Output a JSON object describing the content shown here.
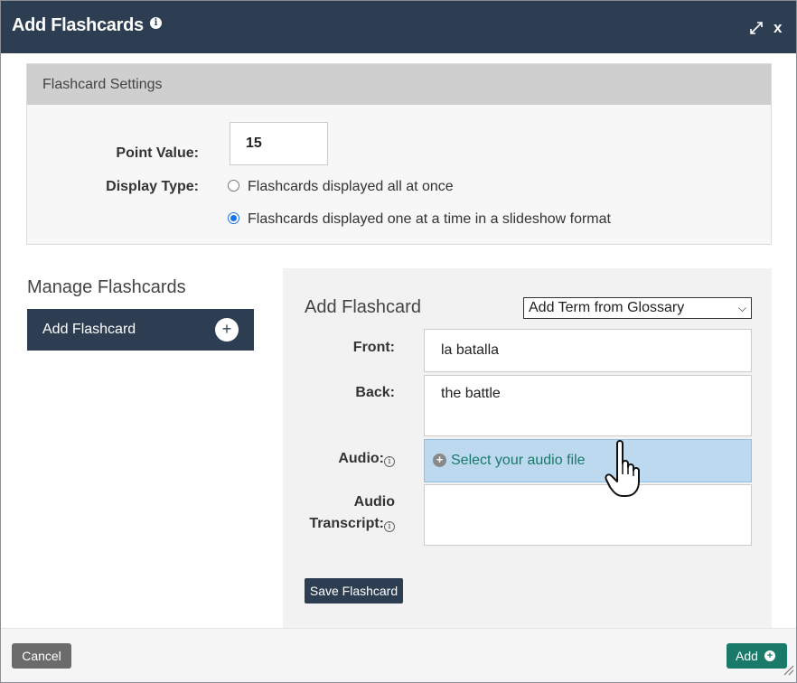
{
  "dialog": {
    "title": "Add Flashcards",
    "info_icon": "info-icon",
    "expand_icon": "expand-icon",
    "close_label": "x"
  },
  "settings": {
    "header": "Flashcard Settings",
    "point_value_label": "Point Value:",
    "point_value": "15",
    "display_type_label": "Display Type:",
    "display_options": [
      {
        "label": "Flashcards displayed all at once",
        "selected": false
      },
      {
        "label": "Flashcards displayed one at a time in a slideshow format",
        "selected": true
      }
    ]
  },
  "manage": {
    "title": "Manage Flashcards",
    "add_tab_label": "Add Flashcard",
    "add_tab_icon": "plus-icon"
  },
  "editor": {
    "title": "Add Flashcard",
    "glossary_select": "Add Term from Glossary",
    "front_label": "Front:",
    "front_value": "la batalla",
    "back_label": "Back:",
    "back_value": "the battle",
    "audio_label": "Audio:",
    "audio_button": "Select your audio file",
    "transcript_label_1": "Audio",
    "transcript_label_2": "Transcript:",
    "transcript_value": "",
    "save_button": "Save Flashcard"
  },
  "footer": {
    "cancel": "Cancel",
    "add": "Add"
  },
  "colors": {
    "header_bg": "#2e3e52",
    "accent_teal": "#1a7a6a",
    "audio_btn_bg": "#bcd9ef",
    "cancel_bg": "#6b6b6b"
  }
}
